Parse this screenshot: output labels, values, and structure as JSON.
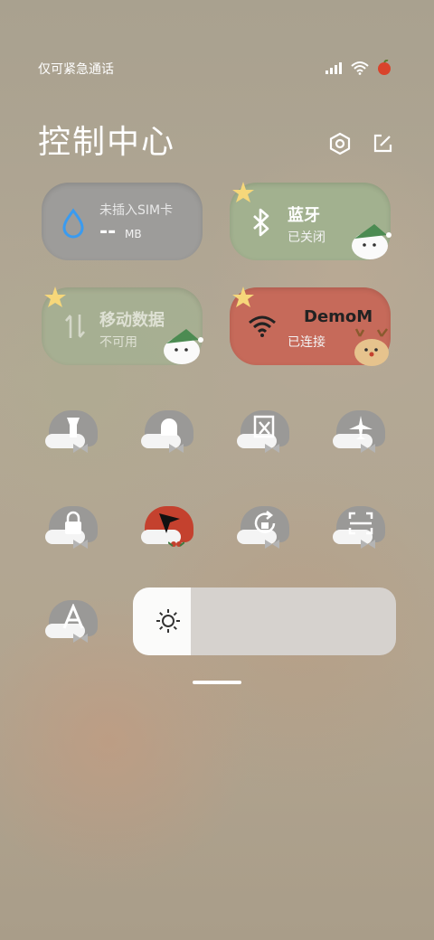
{
  "status_bar": {
    "carrier_text": "仅可紧急通话",
    "icons": [
      "signal-icon",
      "wifi-icon",
      "battery-icon"
    ]
  },
  "header": {
    "title": "控制中心",
    "icons": [
      "settings-icon",
      "edit-icon"
    ]
  },
  "tiles": {
    "sim": {
      "title": "未插入SIM卡",
      "value": "--",
      "unit": "MB",
      "icon": "water-drop-icon"
    },
    "bluetooth": {
      "title": "蓝牙",
      "status": "已关闭",
      "icon": "bluetooth-icon"
    },
    "mobile_data": {
      "title": "移动数据",
      "status": "不可用",
      "icon": "data-arrows-icon"
    },
    "wifi": {
      "title": "DemoM",
      "status": "已连接",
      "icon": "wifi-icon"
    }
  },
  "toggles": [
    {
      "name": "flashlight",
      "icon": "flashlight-icon",
      "active": false
    },
    {
      "name": "silent",
      "icon": "bell-icon",
      "active": false
    },
    {
      "name": "screenshot",
      "icon": "screenshot-icon",
      "active": false
    },
    {
      "name": "airplane",
      "icon": "airplane-icon",
      "active": false
    },
    {
      "name": "lock",
      "icon": "lock-icon",
      "active": false
    },
    {
      "name": "location",
      "icon": "location-arrow-icon",
      "active": true
    },
    {
      "name": "rotation-lock",
      "icon": "rotation-icon",
      "active": false
    },
    {
      "name": "scanner",
      "icon": "scan-icon",
      "active": false
    },
    {
      "name": "auto-font",
      "icon": "letter-a-icon",
      "active": false
    }
  ],
  "brightness": {
    "level": 0.22,
    "icon": "sun-icon"
  },
  "colors": {
    "gray_tile": "#9d9c9a",
    "green_tile": "#a2b18f",
    "red_tile": "#c66a5a",
    "accent_blue": "#3a9bf0",
    "santa_red": "#c4412e"
  }
}
